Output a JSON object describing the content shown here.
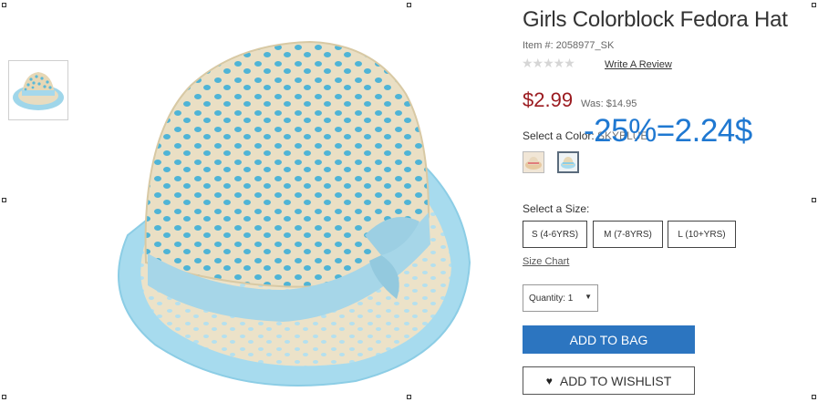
{
  "product": {
    "title": "Girls Colorblock Fedora Hat",
    "item_number": "Item #: 2058977_SK",
    "rating_stars": "★★★★★",
    "rating_value": 0,
    "review_link": "Write A Review",
    "price": "$2.99",
    "was_price": "Was: $14.95"
  },
  "annotation": {
    "discount_text": "-25%=2.24$",
    "color": "#1f78d1"
  },
  "color_select": {
    "label": "Select a Color: ",
    "selected": "SKYBLUE",
    "swatches": [
      "multicolor",
      "skyblue"
    ]
  },
  "size_select": {
    "label": "Select a Size:",
    "options": [
      "S (4-6YRS)",
      "M (7-8YRS)",
      "L (10+YRS)"
    ],
    "chart_link": "Size Chart"
  },
  "quantity": {
    "label": "Quantity: 1",
    "arrow": "▼"
  },
  "actions": {
    "add_to_bag": "ADD TO BAG",
    "add_to_wishlist": "ADD TO WISHLIST",
    "heart_glyph": "♥"
  },
  "colors": {
    "price_red": "#9b1b20",
    "button_blue": "#2c75c0"
  },
  "icons": [
    "heart-icon",
    "chevron-down-icon",
    "star-icon"
  ]
}
